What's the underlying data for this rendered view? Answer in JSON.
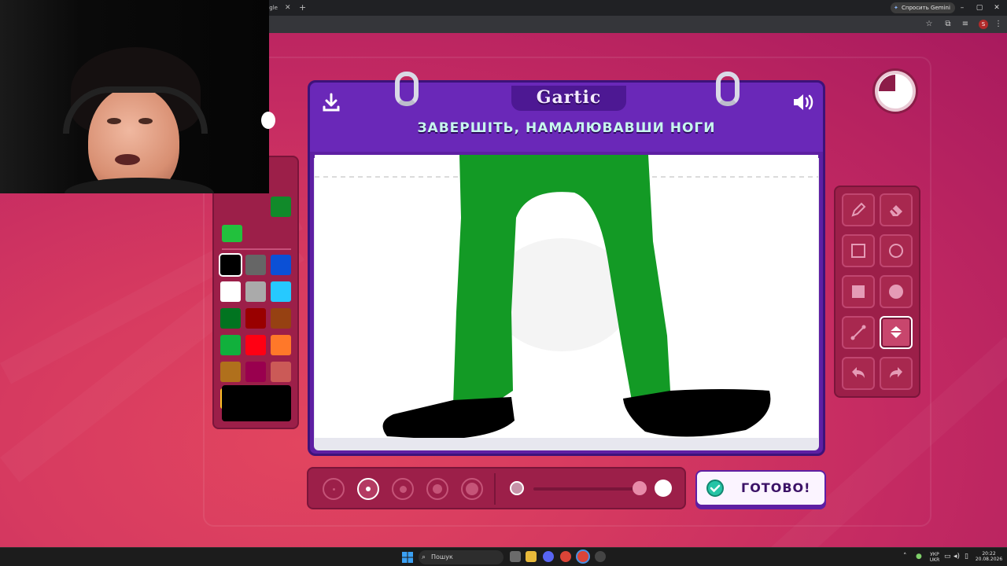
{
  "browser": {
    "tab_title": "ogle",
    "tab_close": "✕",
    "new_tab": "+",
    "gemini_label": "Спросить Gemini",
    "window_controls": [
      "–",
      "▢",
      "✕"
    ],
    "toolbar_icons": [
      "star-icon",
      "extensions-icon",
      "media-icon",
      "profile-icon",
      "menu-icon"
    ],
    "profile_initial": "S"
  },
  "game": {
    "logo": "Gartic",
    "prompt": "ЗАВЕРШІТЬ, НАМАЛЮВАВШИ НОГИ",
    "done_button": "ГОТОВО!",
    "colors": {
      "background": "#d63a60",
      "board": "#5e1fa3",
      "accent": "#26c4a6",
      "prompt_text": "#c8f7ee"
    },
    "recent_colors": [
      "#118a2a",
      "#22c13d"
    ],
    "palette": [
      "#000000",
      "#666666",
      "#0b50d6",
      "#ffffff",
      "#aaaaaa",
      "#26c9ff",
      "#017420",
      "#990000",
      "#964112",
      "#11b03c",
      "#ff0013",
      "#ff7829",
      "#b0701c",
      "#99004e",
      "#cb5a57",
      "#ffc126",
      "#ff008f",
      "#feafa8"
    ],
    "selected_color": "#000000",
    "tools": [
      "pencil-icon",
      "eraser-icon",
      "rectangle-outline-icon",
      "circle-outline-icon",
      "rectangle-fill-icon",
      "circle-fill-icon",
      "line-icon",
      "fill-bucket-icon",
      "undo-icon",
      "redo-icon"
    ],
    "active_tool": "fill-bucket-icon",
    "brush_sizes": 5,
    "selected_brush_size_index": 1,
    "opacity": 1.0
  },
  "taskbar": {
    "search_label": "Пошук",
    "lang_top": "УКР",
    "lang_bottom": "UKR",
    "time": "20:22",
    "date": "20.08.2026"
  }
}
